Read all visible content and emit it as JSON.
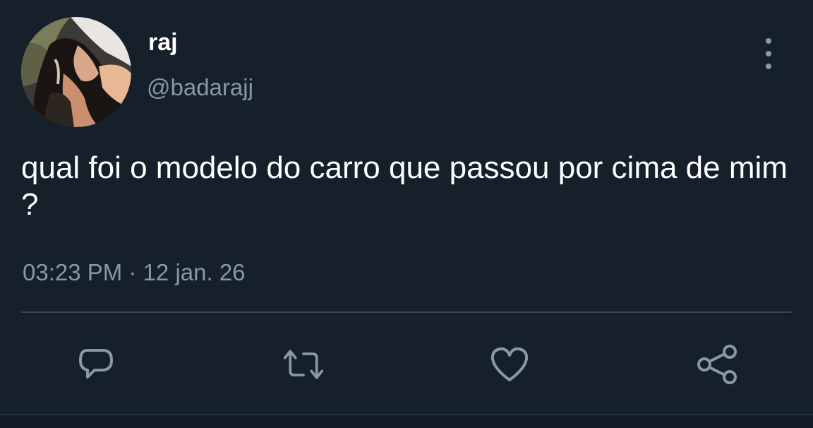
{
  "author": {
    "display_name": "raj",
    "handle": "@badarajj",
    "avatar_icon": "profile-photo"
  },
  "tweet": {
    "text": "qual foi o modelo do carro que passou por cima de mim ?",
    "timestamp": "03:23 PM · 12 jan. 26"
  },
  "actions": {
    "reply_icon": "reply-icon",
    "retweet_icon": "retweet-icon",
    "like_icon": "heart-icon",
    "share_icon": "share-icon"
  },
  "colors": {
    "background": "#15202b",
    "text_primary": "#ffffff",
    "text_secondary": "#8899a6",
    "divider": "#38444d"
  }
}
